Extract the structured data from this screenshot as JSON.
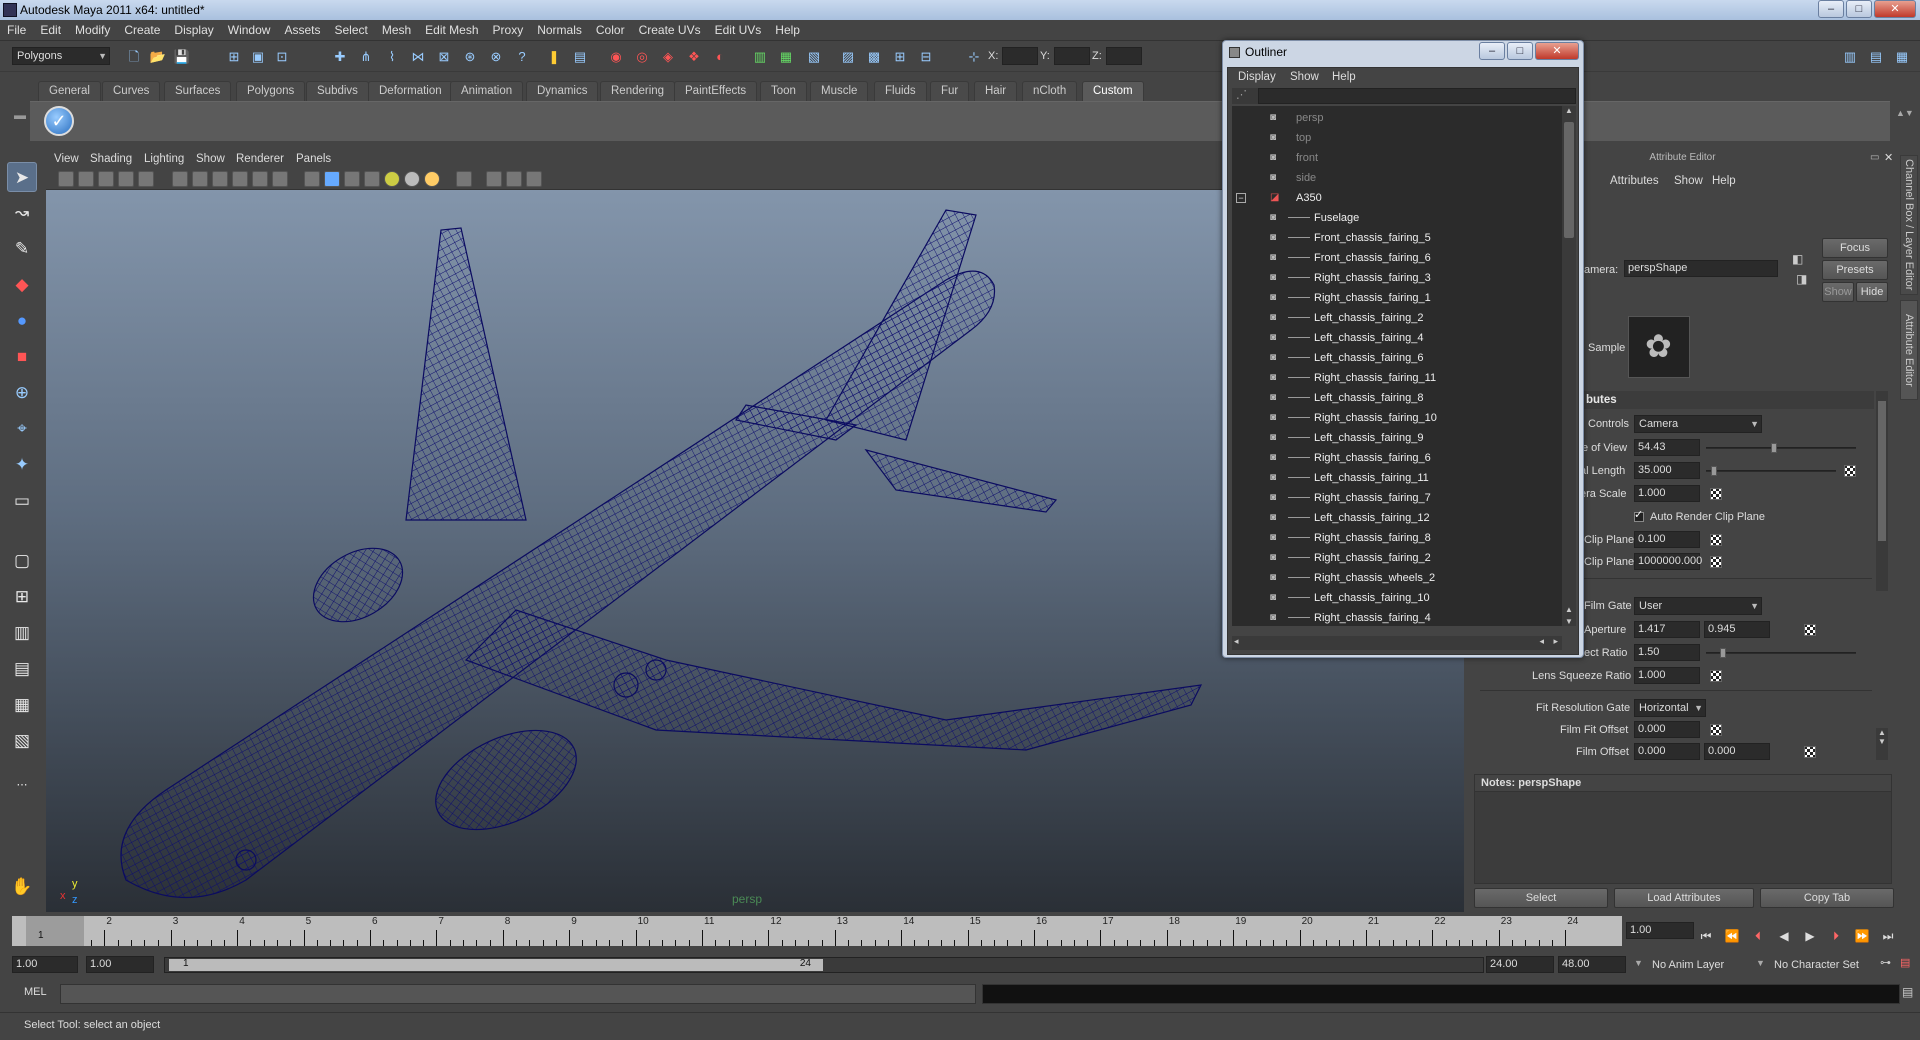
{
  "window": {
    "title": "Autodesk Maya 2011 x64: untitled*"
  },
  "menubar": [
    "File",
    "Edit",
    "Modify",
    "Create",
    "Display",
    "Window",
    "Assets",
    "Select",
    "Mesh",
    "Edit Mesh",
    "Proxy",
    "Normals",
    "Color",
    "Create UVs",
    "Edit UVs",
    "Help"
  ],
  "statusline": {
    "mode": "Polygons",
    "x_label": "X:",
    "y_label": "Y:",
    "z_label": "Z:"
  },
  "shelf_tabs": [
    "General",
    "Curves",
    "Surfaces",
    "Polygons",
    "Subdivs",
    "Deformation",
    "Animation",
    "Dynamics",
    "Rendering",
    "PaintEffects",
    "Toon",
    "Muscle",
    "Fluids",
    "Fur",
    "Hair",
    "nCloth",
    "Custom"
  ],
  "shelf_active": "Custom",
  "viewport": {
    "menu": [
      "View",
      "Shading",
      "Lighting",
      "Show",
      "Renderer",
      "Panels"
    ],
    "camera_label": "persp",
    "axis_x": "x",
    "axis_y": "y",
    "axis_z": "z"
  },
  "outliner": {
    "title": "Outliner",
    "menu": [
      "Display",
      "Show",
      "Help"
    ],
    "cameras": [
      "persp",
      "top",
      "front",
      "side"
    ],
    "group": "A350",
    "children": [
      "Fuselage",
      "Front_chassis_fairing_5",
      "Front_chassis_fairing_6",
      "Right_chassis_fairing_3",
      "Right_chassis_fairing_1",
      "Left_chassis_fairing_2",
      "Left_chassis_fairing_4",
      "Left_chassis_fairing_6",
      "Right_chassis_fairing_11",
      "Left_chassis_fairing_8",
      "Right_chassis_fairing_10",
      "Left_chassis_fairing_9",
      "Right_chassis_fairing_6",
      "Left_chassis_fairing_11",
      "Right_chassis_fairing_7",
      "Left_chassis_fairing_12",
      "Right_chassis_fairing_8",
      "Right_chassis_fairing_2",
      "Right_chassis_wheels_2",
      "Left_chassis_fairing_10",
      "Right_chassis_fairing_4"
    ],
    "collapse_symbol": "−"
  },
  "attribute_editor": {
    "title": "Attribute Editor",
    "menu": [
      "us",
      "Attributes",
      "Show",
      "Help"
    ],
    "camera_label": "amera:",
    "camera_value": "perspShape",
    "buttons": {
      "focus": "Focus",
      "presets": "Presets",
      "show": "Show",
      "hide": "Hide"
    },
    "sample_label": "Sample",
    "section_attributes": "butes",
    "controls_label": "Controls",
    "controls_value": "Camera",
    "fov_label": "e of View",
    "fov_value": "54.43",
    "fov_slider": 0.45,
    "focal_label": "al Length",
    "focal_value": "35.000",
    "focal_slider": 0.04,
    "cam_scale_label": "era Scale",
    "cam_scale_value": "1.000",
    "auto_clip_label": "Auto Render Clip Plane",
    "auto_clip_checked": true,
    "near_label": "Clip Plane",
    "near_value": "0.100",
    "far_label": "Clip Plane",
    "far_value": "1000000.000",
    "film_gate_label": "Film Gate",
    "film_gate_value": "User",
    "aperture_label": "Aperture",
    "aperture_h": "1.417",
    "aperture_v": "0.945",
    "aspect_label": "ect Ratio",
    "aspect_value": "1.50",
    "aspect_slider": 0.1,
    "lens_label": "Lens Squeeze Ratio",
    "lens_value": "1.000",
    "fit_label": "Fit Resolution Gate",
    "fit_value": "Horizontal",
    "film_fit_label": "Film Fit Offset",
    "film_fit_value": "0.000",
    "film_offset_label": "Film Offset",
    "film_offset_x": "0.000",
    "film_offset_y": "0.000",
    "notes_label": "Notes:  perspShape",
    "bottom_buttons": [
      "Select",
      "Load Attributes",
      "Copy Tab"
    ]
  },
  "side_tabs": {
    "channel_box": "Channel Box / Layer Editor",
    "attr_editor": "Attribute Editor"
  },
  "time_slider": {
    "frames": [
      "1",
      "2",
      "3",
      "4",
      "5",
      "6",
      "7",
      "8",
      "9",
      "10",
      "11",
      "12",
      "13",
      "14",
      "15",
      "16",
      "17",
      "18",
      "19",
      "20",
      "21",
      "22",
      "23",
      "24"
    ],
    "current_frame": "1",
    "current_time": "1.00"
  },
  "range_slider": {
    "start": "1.00",
    "anim_start": "1.00",
    "range_start": "1",
    "range_end": "24",
    "anim_end": "24.00",
    "end": "48.00",
    "anim_layer": "No Anim Layer",
    "char_set": "No Character Set"
  },
  "command_line": {
    "label": "MEL"
  },
  "help_line": {
    "text": "Select Tool: select an object"
  }
}
